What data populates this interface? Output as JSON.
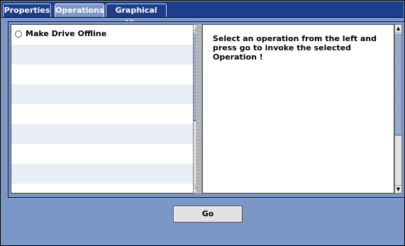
{
  "tabs": [
    {
      "label": "Properties",
      "active": false
    },
    {
      "label": "Operations",
      "active": true
    },
    {
      "label": "Graphical View",
      "active": false
    }
  ],
  "operations": {
    "items": [
      {
        "label": "Make Drive Offline",
        "selected": false
      }
    ]
  },
  "info_panel": {
    "text": "Select an operation from the left and press go to invoke the selected Operation !"
  },
  "go_button": {
    "label": "Go"
  },
  "colors": {
    "background": "#7b97c8",
    "tab_strip": "#1d3f8b",
    "row_alt": "#e8edf6"
  },
  "icons": {
    "scroll_up": "▲",
    "scroll_down": "▼"
  }
}
